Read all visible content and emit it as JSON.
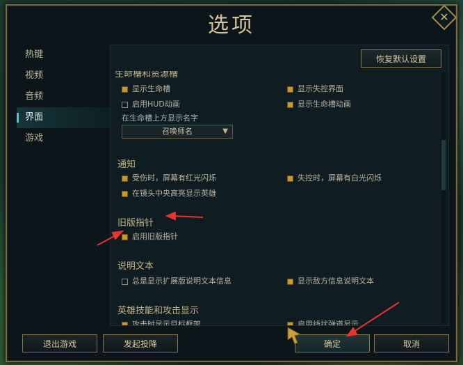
{
  "dialog": {
    "title": "选项",
    "close_symbol": "✕"
  },
  "sidebar": {
    "items": [
      {
        "label": "热键"
      },
      {
        "label": "视频"
      },
      {
        "label": "音频"
      },
      {
        "label": "界面",
        "active": true
      },
      {
        "label": "游戏"
      }
    ]
  },
  "panel": {
    "reset_label": "恢复默认设置",
    "sections": {
      "health": {
        "title_partial": "生命槽和资源槽",
        "opt1": "显示生命槽",
        "opt1_checked": true,
        "opt2": "显示失控界面",
        "opt2_checked": true,
        "opt3": "启用HUD动画",
        "opt3_checked": false,
        "opt4": "显示生命槽动画",
        "opt4_checked": true,
        "name_label": "在生命槽上方显示名字",
        "name_select": "召唤师名"
      },
      "notify": {
        "title": "通知",
        "opt1": "受伤时，屏幕有红光闪烁",
        "opt1_checked": true,
        "opt2": "失控时，屏幕有白光闪烁",
        "opt2_checked": true,
        "opt3": "在镜头中央高亮显示英雄",
        "opt3_checked": true
      },
      "legacy": {
        "title": "旧版指针",
        "opt1": "启用旧版指针",
        "opt1_checked": true
      },
      "desc": {
        "title": "说明文本",
        "opt1": "总是显示扩展版说明文本信息",
        "opt1_checked": false,
        "opt2": "显示敌方信息说明文本",
        "opt2_checked": true
      },
      "skills": {
        "title": "英雄技能和攻击显示",
        "opt1_partial": "攻击时显示目标框架",
        "opt2_partial": "启用线状弹道显示"
      }
    }
  },
  "footer": {
    "quit": "退出游戏",
    "surrender": "发起投降",
    "confirm": "确定",
    "cancel": "取消"
  },
  "colors": {
    "accent_gold": "#c89a2a",
    "annotation_red": "#e8342a",
    "active_bar": "#56c5d0"
  }
}
